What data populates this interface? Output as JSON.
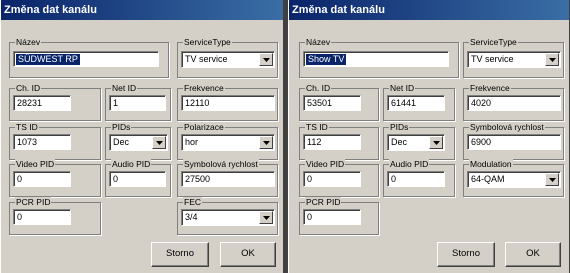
{
  "icons": {
    "dropdown": "dropdown-arrow-icon"
  },
  "colors": {
    "title_bar": "#0a246a",
    "selection": "#0a246a",
    "face": "#d4d0c8"
  },
  "dialogs": [
    {
      "title": "Změna dat kanálu",
      "labels": {
        "name": "Název",
        "service_type": "ServiceType",
        "ch_id": "Ch. ID",
        "net_id": "Net ID",
        "frequency": "Frekvence",
        "ts_id": "TS ID",
        "pids": "PIDs",
        "param": "Polarizace",
        "video_pid": "Video PID",
        "audio_pid": "Audio PID",
        "symbol_rate": "Symbolová rychlost",
        "pcr_pid": "PCR PID",
        "fec": "FEC"
      },
      "values": {
        "name": "SÜDWEST RP",
        "service_type": "TV service",
        "ch_id": "28231",
        "net_id": "1",
        "frequency": "12110",
        "ts_id": "1073",
        "pids": "Dec",
        "param": "hor",
        "video_pid": "0",
        "audio_pid": "0",
        "symbol_rate": "27500",
        "pcr_pid": "0",
        "fec": "3/4"
      },
      "buttons": {
        "cancel": "Storno",
        "ok": "OK"
      }
    },
    {
      "title": "Změna dat kanálu",
      "labels": {
        "name": "Název",
        "service_type": "ServiceType",
        "ch_id": "Ch. ID",
        "net_id": "Net ID",
        "frequency": "Frekvence",
        "ts_id": "TS ID",
        "pids": "PIDs",
        "symbol_rate": "Symbolová rychlost",
        "video_pid": "Video PID",
        "audio_pid": "Audio PID",
        "modulation": "Modulation",
        "pcr_pid": "PCR PID"
      },
      "values": {
        "name": "Show TV",
        "service_type": "TV service",
        "ch_id": "53501",
        "net_id": "61441",
        "frequency": "4020",
        "ts_id": "112",
        "pids": "Dec",
        "symbol_rate": "6900",
        "video_pid": "0",
        "audio_pid": "0",
        "modulation": "64-QAM",
        "pcr_pid": "0"
      },
      "buttons": {
        "cancel": "Storno",
        "ok": "OK"
      }
    }
  ]
}
